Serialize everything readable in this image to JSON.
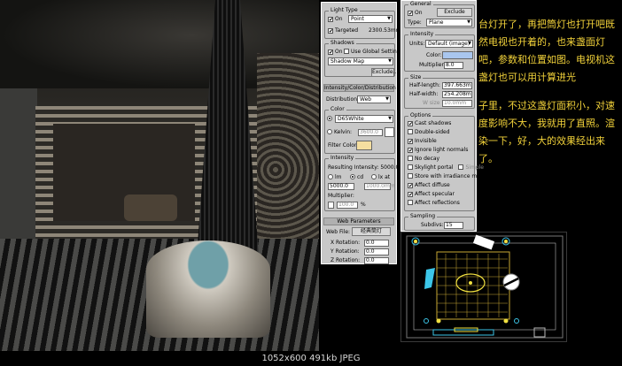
{
  "caption": "1052x600 491kb JPEG",
  "panel_left": {
    "light_type": {
      "title": "Light Type",
      "on_label": "On",
      "type_value": "Point",
      "targeted_label": "Targeted",
      "targeted_value": "2300.53mm"
    },
    "shadows": {
      "title": "Shadows",
      "on_label": "On",
      "use_global_label": "Use Global Settings",
      "map_value": "Shadow Map",
      "exclude_label": "Exclude..."
    },
    "intensity_rollout": {
      "title": "Intensity/Color/Distribution",
      "distribution_label": "Distribution:",
      "distribution_value": "Web"
    },
    "color": {
      "title": "Color",
      "preset_value": "D65White",
      "kelvin_label": "Kelvin:",
      "kelvin_value": "3600.0",
      "filter_label": "Filter Color:",
      "filter_color": "#f5dea0"
    },
    "intensity": {
      "title": "Intensity",
      "resulting_label": "Resulting Intensity: 5000.0 cd",
      "lm_label": "lm",
      "cd_label": "cd",
      "lx_label": "lx at",
      "value": "5000.0",
      "lx_value": "1000.0mm",
      "multiplier_label": "Multiplier:",
      "multiplier_value": "100.0",
      "percent": "%"
    },
    "web": {
      "title": "Web Parameters",
      "file_label": "Web File:",
      "file_value": "经典筒灯",
      "x_label": "X Rotation:",
      "x_value": "0.0",
      "y_label": "Y Rotation:",
      "y_value": "0.0",
      "z_label": "Z Rotation:",
      "z_value": "0.0"
    }
  },
  "panel_right": {
    "general": {
      "title": "General",
      "on_label": "On",
      "exclude_label": "Exclude",
      "type_label": "Type:",
      "type_value": "Plane"
    },
    "intensity": {
      "title": "Intensity",
      "units_label": "Units:",
      "units_value": "Default (image)",
      "color_label": "Color:",
      "color_swatch": "#a9c6ee",
      "multiplier_label": "Multiplier:",
      "multiplier_value": "8.0"
    },
    "size": {
      "title": "Size",
      "half_length_label": "Half-length:",
      "half_length_value": "397.663m",
      "half_width_label": "Half-width:",
      "half_width_value": "254.208m",
      "w_size_label": "W size",
      "w_size_value": "10.0mm"
    },
    "options": {
      "title": "Options",
      "items": [
        {
          "label": "Cast shadows",
          "checked": true
        },
        {
          "label": "Double-sided",
          "checked": false
        },
        {
          "label": "Invisible",
          "checked": true
        },
        {
          "label": "Ignore light normals",
          "checked": true
        },
        {
          "label": "No decay",
          "checked": false
        },
        {
          "label": "Skylight portal",
          "checked": false,
          "extra": "Simple"
        },
        {
          "label": "Store with irradiance map",
          "checked": false
        },
        {
          "label": "Affect diffuse",
          "checked": true
        },
        {
          "label": "Affect specular",
          "checked": true
        },
        {
          "label": "Affect reflections",
          "checked": false
        }
      ]
    },
    "sampling": {
      "title": "Sampling",
      "subdivs_label": "Subdivs:",
      "subdivs_value": "15"
    }
  },
  "note1": "台灯开了，再把筒灯也打开吧既然电视也开着的，也来盏面灯吧，参数和位置如图。电视机这盏灯也可以用计算进光",
  "note2": "子里，不过这盏灯面积小，对速度影响不大，我就用了直照。渲染一下，好，大的效果经出来了。",
  "colors": {
    "annotation": "#f2d23a",
    "panel_bg": "#c8c8c8"
  }
}
